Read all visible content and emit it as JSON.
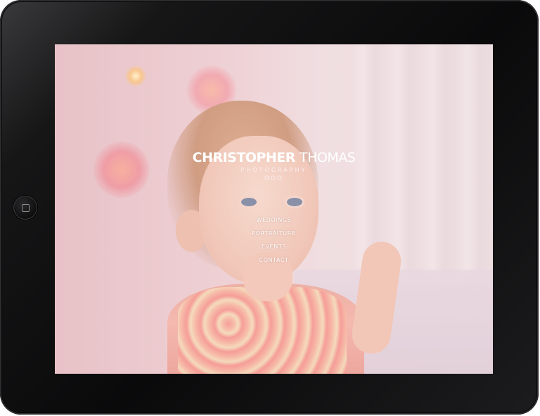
{
  "brand": {
    "first": "CHRISTOPHER",
    "last": "THOMAS",
    "subtitle": "PHOTOGRAPHY",
    "dots": "OOO"
  },
  "nav": [
    {
      "label": "WEDDINGS"
    },
    {
      "label": "PORTRAITURE"
    },
    {
      "label": "EVENTS"
    },
    {
      "label": "CONTACT"
    }
  ],
  "colors": {
    "bezel": "#0a0a0b",
    "text": "#ffffff",
    "background_tint": "#e6c9c9"
  },
  "icons": {
    "home_button": "home-button-icon"
  }
}
